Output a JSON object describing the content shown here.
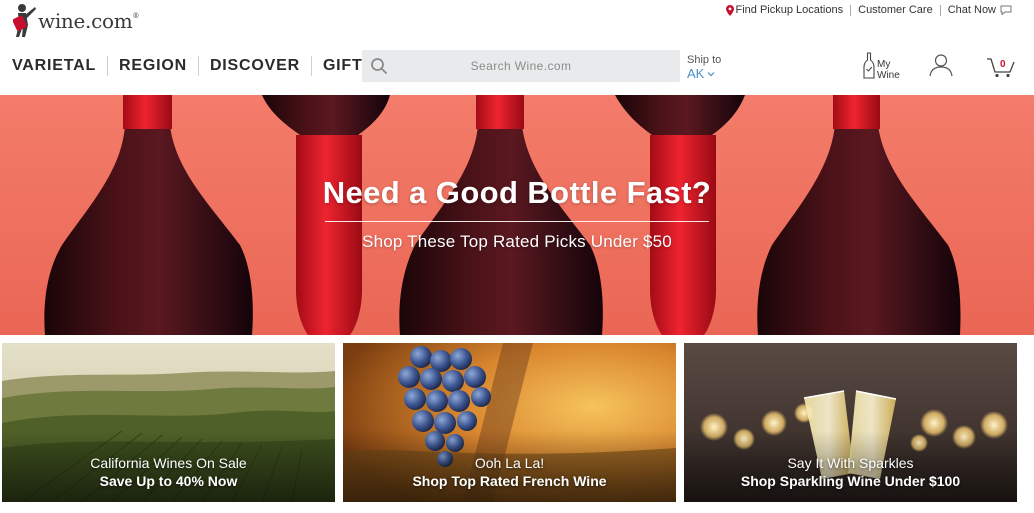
{
  "brand": {
    "name": "wine.com",
    "trademark": "®"
  },
  "utility": {
    "find_pickup": "Find Pickup Locations",
    "customer_care": "Customer Care",
    "chat_now": "Chat Now"
  },
  "nav": {
    "items": [
      {
        "label": "VARIETAL"
      },
      {
        "label": "REGION"
      },
      {
        "label": "DISCOVER"
      },
      {
        "label": "GIFTS"
      }
    ]
  },
  "search": {
    "placeholder": "Search Wine.com"
  },
  "ship_to": {
    "label": "Ship to",
    "state": "AK"
  },
  "my_wine": {
    "line1": "My",
    "line2": "Wine"
  },
  "cart": {
    "count": "0"
  },
  "hero": {
    "headline": "Need a Good Bottle Fast?",
    "subline": "Shop These Top Rated Picks Under $50",
    "background_color": "#f0715e",
    "bottle_color": "#3a0e14",
    "capsule_color": "#d8121e"
  },
  "promos": [
    {
      "line1": "California Wines On Sale",
      "line2": "Save Up to 40% Now"
    },
    {
      "line1": "Ooh La La!",
      "line2": "Shop Top Rated French Wine"
    },
    {
      "line1": "Say It With Sparkles",
      "line2": "Shop Sparkling Wine Under $100"
    }
  ],
  "colors": {
    "accent_red": "#c8102e",
    "link_blue": "#4a8fc4"
  }
}
